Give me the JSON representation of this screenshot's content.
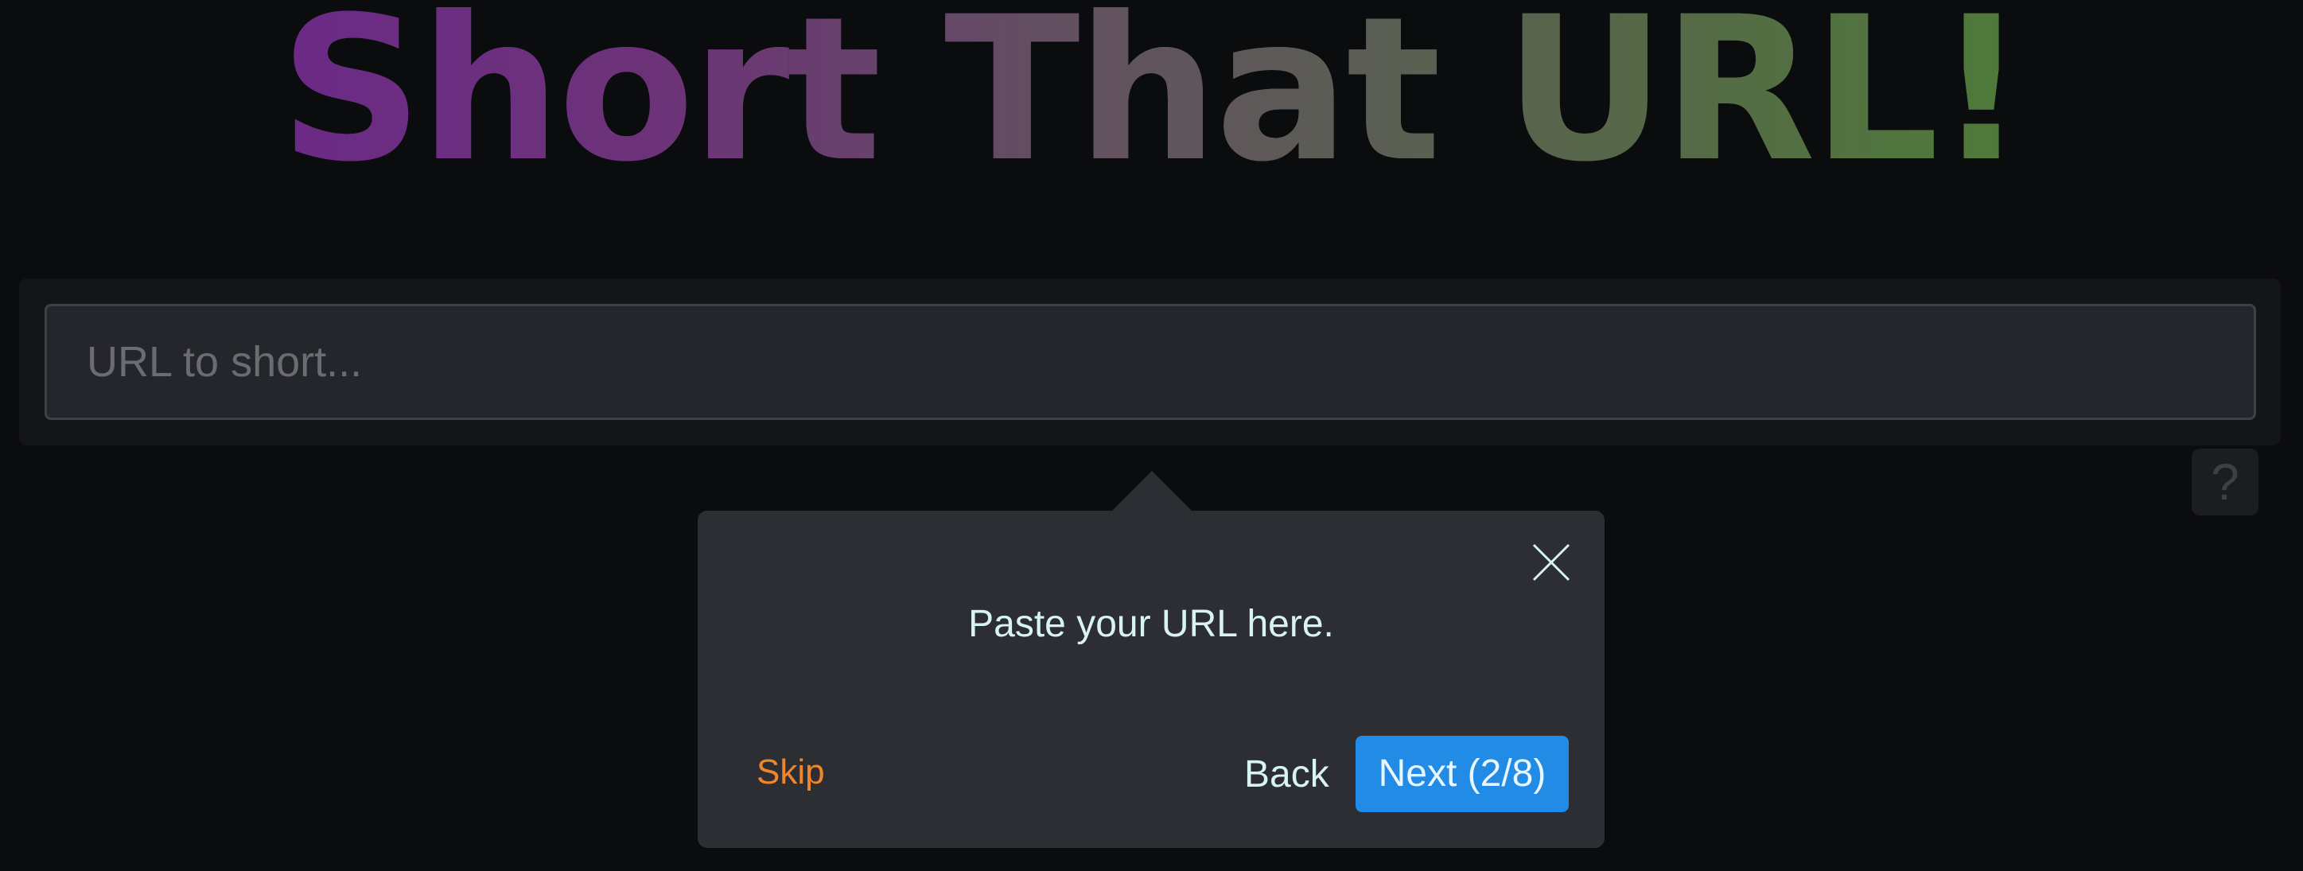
{
  "header": {
    "title": "Short That URL!"
  },
  "search": {
    "placeholder": "URL to short...",
    "value": ""
  },
  "help": {
    "label": "?"
  },
  "tour": {
    "message": "Paste your URL here.",
    "skip_label": "Skip",
    "back_label": "Back",
    "next_label": "Next (2/8)",
    "step_current": 2,
    "step_total": 8
  },
  "icons": {
    "close": "close-icon"
  },
  "colors": {
    "background": "#0b0c0e",
    "title_start": "#6b2a86",
    "title_end": "#4e7a3a",
    "accent": "#228be6",
    "skip": "#f0862a",
    "popover_text": "#d8f3f3"
  }
}
